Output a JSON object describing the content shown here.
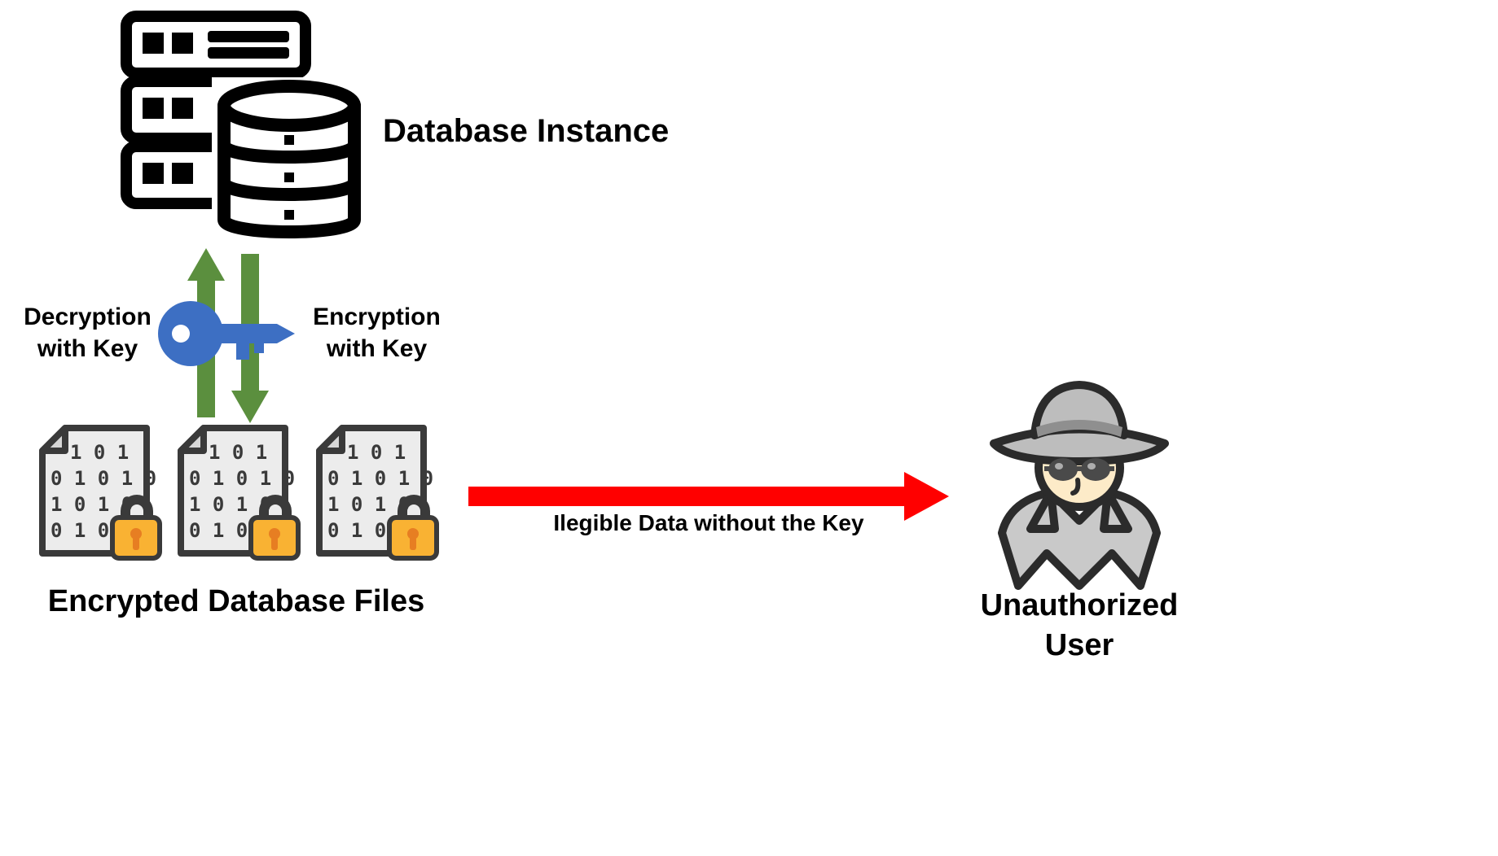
{
  "labels": {
    "database_instance": "Database Instance",
    "decryption": "Decryption\nwith Key",
    "encryption": "Encryption\nwith Key",
    "encrypted_files": "Encrypted Database Files",
    "illegible": "Ilegible Data without the Key",
    "unauthorized": "Unauthorized\nUser"
  },
  "colors": {
    "arrow_green": "#5b8f3e",
    "arrow_red": "#ff0000",
    "key_blue": "#3d6fc3",
    "lock_body": "#f9b233",
    "lock_hole": "#e77e22",
    "file_fill": "#ececec",
    "file_stroke": "#3a3a3a",
    "db_stroke": "#000000",
    "spy_coat": "#c9c9c9",
    "spy_hat": "#bdbdbd",
    "spy_face": "#fdebc8",
    "spy_glasses": "#4a4a4a"
  },
  "icons": {
    "database": "database-server-icon",
    "key": "key-icon",
    "arrows": "bidirectional-arrows-icon",
    "file_locked": "encrypted-file-icon",
    "red_arrow": "right-arrow-icon",
    "spy": "unauthorized-user-icon"
  }
}
